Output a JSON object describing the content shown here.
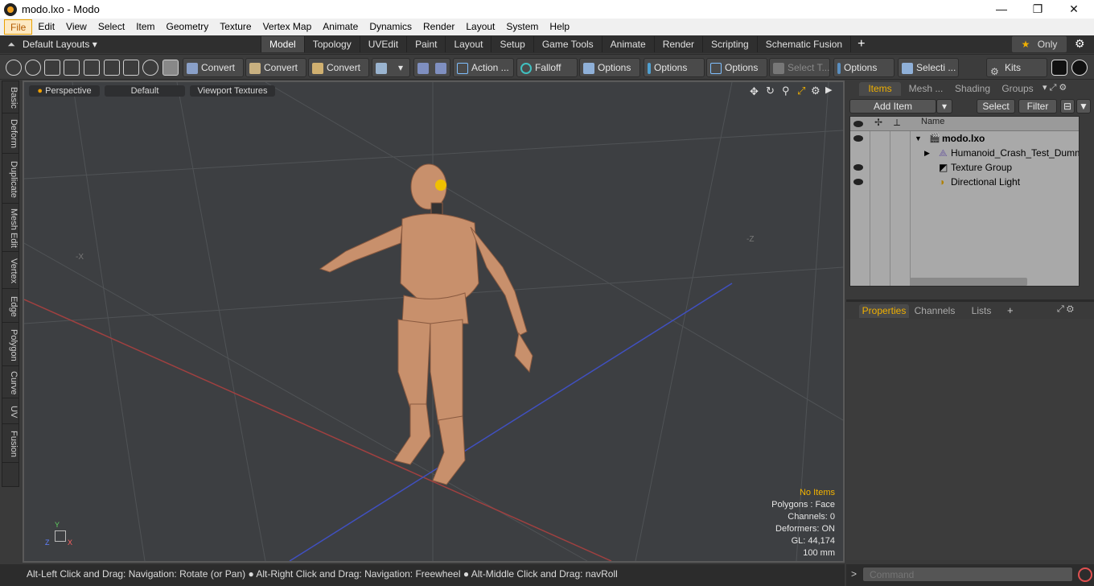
{
  "window": {
    "title": "modo.lxo - Modo",
    "minimize": "—",
    "maximize": "❐",
    "close": "✕"
  },
  "menu": [
    "File",
    "Edit",
    "View",
    "Select",
    "Item",
    "Geometry",
    "Texture",
    "Vertex Map",
    "Animate",
    "Dynamics",
    "Render",
    "Layout",
    "System",
    "Help"
  ],
  "layoutbar": {
    "layouts_label": "Default Layouts ▾",
    "tabs": [
      "Model",
      "Topology",
      "UVEdit",
      "Paint",
      "Layout",
      "Setup",
      "Game Tools",
      "Animate",
      "Render",
      "Scripting",
      "Schematic Fusion"
    ],
    "active_tab": "Model",
    "add": "+",
    "only_label": "Only",
    "star": "★",
    "gear": "⚙"
  },
  "toolbar": {
    "convert1": "Convert",
    "convert2": "Convert",
    "convert3": "Convert",
    "action": "Action ...",
    "falloff": "Falloff",
    "options1": "Options",
    "options2": "Options",
    "options3": "Options",
    "select_t": "Select T...",
    "options4": "Options",
    "selecti": "Selecti ...",
    "kits": "Kits"
  },
  "lefttabs": [
    "Basic",
    "Deform",
    "Duplicate",
    "Mesh Edit",
    "Vertex",
    "Edge",
    "Polygon",
    "Curve",
    "UV",
    "Fusion"
  ],
  "viewport": {
    "view": "Perspective",
    "shading": "Default",
    "textures": "Viewport Textures",
    "axis_x": "-X",
    "axis_z": "-Z",
    "gizmo_y": "Y",
    "gizmo_z": "Z",
    "gizmo_x": "X",
    "info": {
      "selection": "No Items",
      "polygons": "Polygons : Face",
      "channels": "Channels: 0",
      "deformers": "Deformers: ON",
      "gl": "GL: 44,174",
      "scale": "100 mm"
    },
    "colors": {
      "selection": "#f5b400",
      "x_axis": "#c04040",
      "z_axis": "#4050c8"
    }
  },
  "items_panel": {
    "tabs": [
      "Items",
      "Mesh ...",
      "Shading",
      "Groups"
    ],
    "active_tab": "Items",
    "add_item": "Add Item",
    "select": "Select",
    "filter": "Filter",
    "name_header": "Name",
    "rows": [
      {
        "label": "modo.lxo",
        "eye": true
      },
      {
        "label": "Humanoid_Crash_Test_Dummy",
        "eye": false
      },
      {
        "label": "Texture Group",
        "eye": true
      },
      {
        "label": "Directional Light",
        "eye": true
      }
    ]
  },
  "properties_panel": {
    "tabs": [
      "Properties",
      "Channels",
      "Lists"
    ],
    "active_tab": "Properties",
    "add": "+"
  },
  "status": {
    "hint": "Alt-Left Click and Drag: Navigation: Rotate (or Pan) ● Alt-Right Click and Drag: Navigation: Freewheel ● Alt-Middle Click and Drag: navRoll"
  },
  "command": {
    "placeholder": "Command",
    "prompt": ">"
  }
}
